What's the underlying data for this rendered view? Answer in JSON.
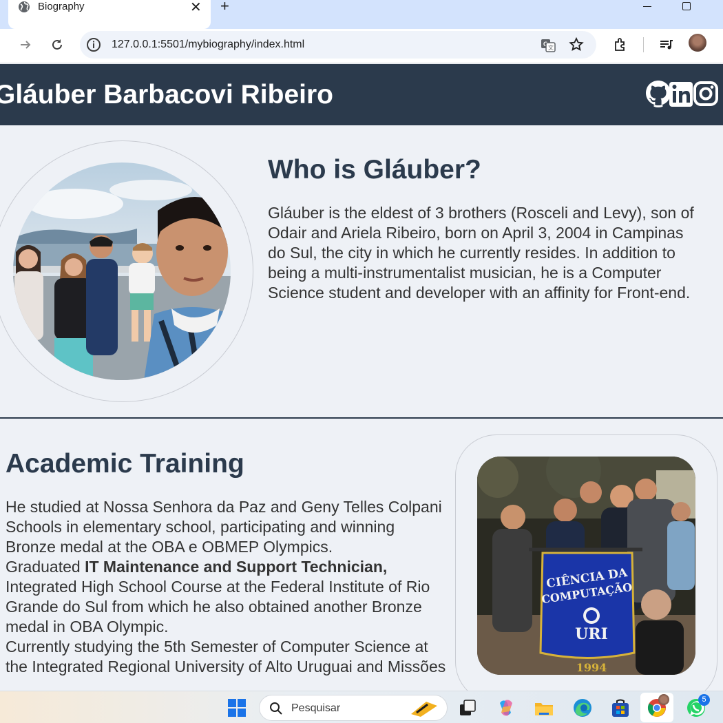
{
  "browser": {
    "tab_title": "Biography",
    "url": "127.0.0.1:5501/mybiography/index.html"
  },
  "header": {
    "title": "Gláuber Barbacovi Ribeiro",
    "social": [
      "github-icon",
      "linkedin-icon",
      "instagram-icon"
    ]
  },
  "about": {
    "heading": "Who is Gláuber?",
    "text": "Gláuber is the eldest of 3 brothers (Rosceli and Levy), son of Odair and Ariela Ribeiro, born on April 3, 2004 in Campinas do Sul, the city in which he currently resides. In addition to being a multi-instrumentalist musician, he is a Computer Science student and developer with an affinity for Front-end."
  },
  "academic": {
    "heading": "Academic Training",
    "text_1": "He studied at Nossa Senhora da Paz and Geny Telles Colpani Schools in elementary school, participating and winning Bronze medal at the OBA e OBMEP Olympics.",
    "text_2_prefix": "Graduated ",
    "text_2_bold": "IT Maintenance and Support Technician,",
    "text_2_rest": " Integrated High School Course at the Federal Institute of Rio Grande do Sul from which he also obtained another Bronze medal in OBA Olympic.",
    "text_3": "Currently studying the 5th Semester of Computer Science at the Integrated Regional University of Alto Uruguai and Missões",
    "banner_line1": "CIÊNCIA DA",
    "banner_line2": "COMPUTAÇÃO",
    "banner_logo": "URI",
    "banner_year": "1994"
  },
  "taskbar": {
    "search_placeholder": "Pesquisar",
    "whatsapp_badge": "5"
  },
  "colors": {
    "header_bg": "#2b3a4c",
    "page_bg": "#eef1f6",
    "heading": "#2b3a4c",
    "text": "#333333"
  }
}
